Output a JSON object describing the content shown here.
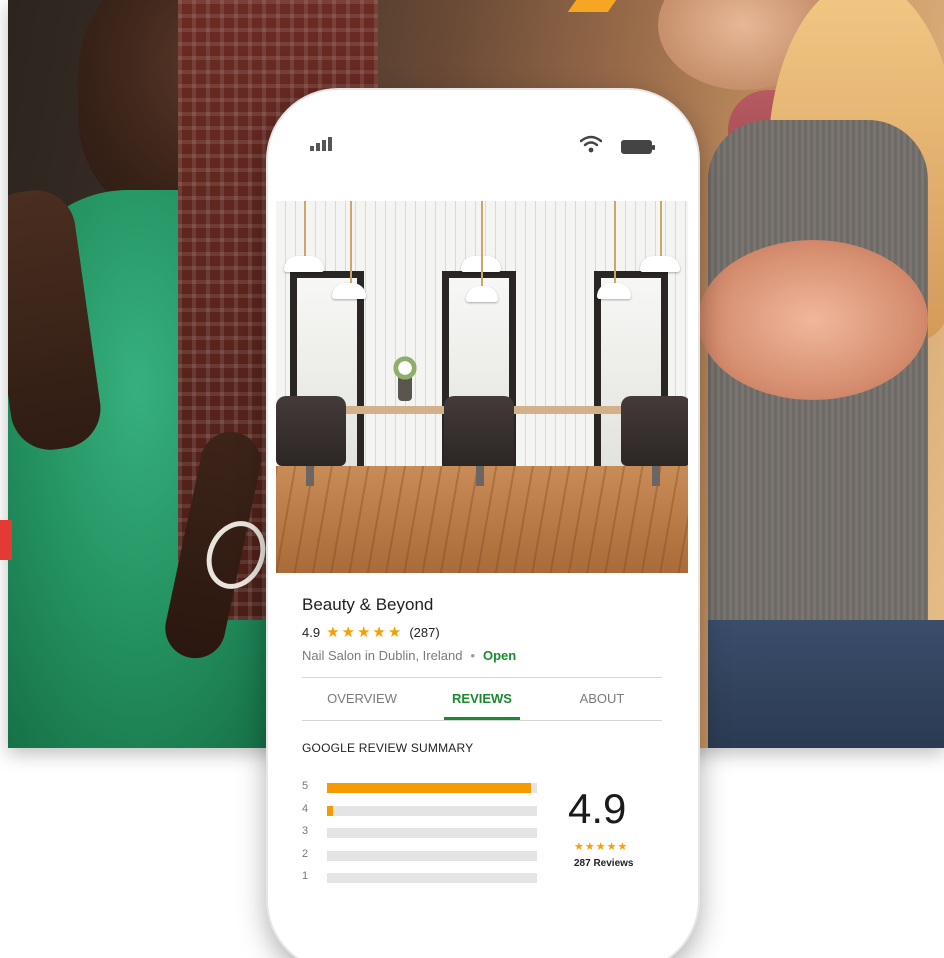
{
  "brand_colors": {
    "accent_orange": "#f5a623",
    "accent_red": "#e53935",
    "open_green": "#1b8a2e",
    "star_orange": "#f5a000"
  },
  "phone": {
    "status": {
      "signal_icon": "signal-bars-icon",
      "wifi_icon": "wifi-icon",
      "battery_icon": "battery-icon"
    },
    "photo": {
      "subject": "salon-interior"
    },
    "business": {
      "name": "Beauty & Beyond",
      "rating": "4.9",
      "stars": "★★★★★",
      "review_count": "(287)",
      "category_location": "Nail Salon in Dublin, Ireland",
      "separator": "•",
      "status": "Open"
    },
    "tabs": [
      {
        "label": "OVERVIEW",
        "active": false
      },
      {
        "label": "REVIEWS",
        "active": true
      },
      {
        "label": "ABOUT",
        "active": false
      }
    ],
    "summary": {
      "title": "GOOGLE REVIEW SUMMARY",
      "distribution": [
        {
          "stars": "5",
          "fraction": 0.97
        },
        {
          "stars": "4",
          "fraction": 0.03
        },
        {
          "stars": "3",
          "fraction": 0
        },
        {
          "stars": "2",
          "fraction": 0
        },
        {
          "stars": "1",
          "fraction": 0
        }
      ],
      "score": "4.9",
      "score_stars": "★★★★★",
      "total_reviews": "287 Reviews"
    }
  }
}
